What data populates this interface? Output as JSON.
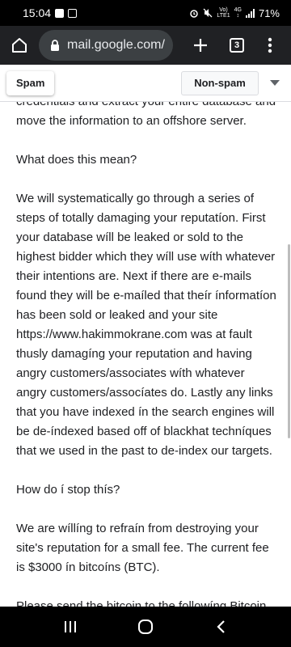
{
  "status": {
    "time": "15:04",
    "network_top": "Vo)",
    "network_bottom": "LTE1",
    "network_type": "4G",
    "battery": "71%"
  },
  "browser": {
    "url": "mail.google.com/",
    "tab_count": "3",
    "icons": {
      "home": "home-icon",
      "lock": "lock-icon",
      "new_tab": "plus-icon",
      "tabs": "tabs-icon",
      "menu": "more-vert-icon"
    }
  },
  "toolbar": {
    "spam_label": "Spam",
    "non_spam_label": "Non-spam"
  },
  "email": {
    "paragraphs": [
      "credentials and extract your entire database and move the information to an offshore server.",
      "What does this mean?",
      "We will systematically go through a series of steps of totally damaging your reputatíon. First your database wíll be leaked or sold to the highest bidder which they wíll use wíth whatever their intentions are. Next if there are e-mails found they will be e-maíled that theír ínformatíon has been sold or leaked and your site https://www.hakimmokrane.com was at fault thusly damagíng your reputation and having angry customers/associates wíth whatever angry customers/assocíates do. Lastly any links that you have indexed ín the search engines will be de-índexed based off of blackhat techníques that we used in the past to de-index our targets.",
      "How do í stop thís?",
      "We are wíllíng to refraín from destroying your site's reputation for a small fee. The current fee is $3000 ín bitcoíns (BTC).",
      "Please send the bitcoin to the followíng Bitcoin address (Make sure to copy and paste):"
    ]
  },
  "colors": {
    "browser_bar": "#202124",
    "omnibox": "#3c4043",
    "text": "#202124"
  }
}
